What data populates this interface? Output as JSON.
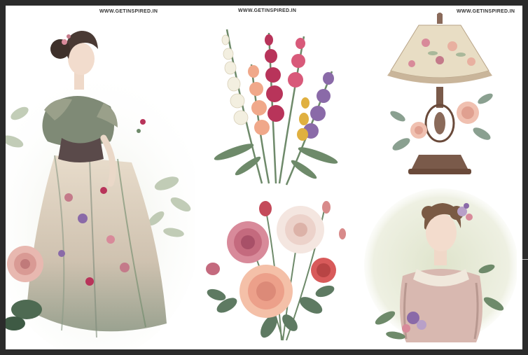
{
  "watermarks": {
    "left": "WWW.GETINSPIRED.IN",
    "center": "WWW.GETINSPIRED.IN",
    "right": "WWW.GETINSPIRED.IN"
  },
  "colors": {
    "frame": "#2b2b2b",
    "canvas": "#ffffff",
    "rose_pink": "#d88a9a",
    "peach": "#f0a88a",
    "leaf_green": "#6e8a6a",
    "sage": "#a9b89a",
    "magenta": "#b8345a",
    "lavender": "#8a6aa8",
    "gold": "#e0b040",
    "antique_brown": "#6a4a3a"
  },
  "items": [
    {
      "icon": "victorian-lady-icon"
    },
    {
      "icon": "snapdragon-bouquet-icon"
    },
    {
      "icon": "floral-lamp-icon"
    },
    {
      "icon": "peony-bouquet-icon"
    },
    {
      "icon": "lady-portrait-icon"
    }
  ]
}
